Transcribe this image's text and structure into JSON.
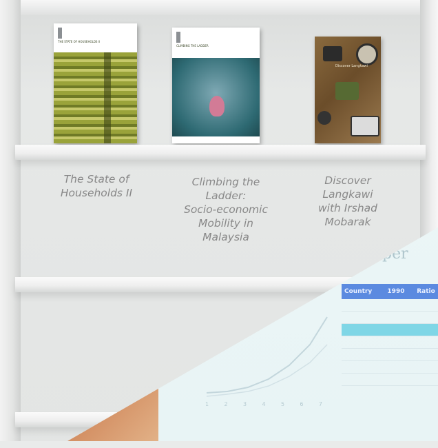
{
  "books": [
    {
      "cover_title": "THE STATE OF HOUSEHOLDS II",
      "caption": "The State of\nHouseholds II"
    },
    {
      "cover_title": "CLIMBING THE LADDER",
      "caption": "Climbing the\nLadder:\nSocio-economic\nMobility in\nMalaysia"
    },
    {
      "cover_title": "Discover Langkawi",
      "caption": "Discover\nLangkawi\nwith Irshad\nMobarak"
    }
  ],
  "overlay": {
    "title": "per",
    "table_header": [
      "Country",
      "1990",
      "Ratio"
    ],
    "table_rows": [
      [
        "",
        "",
        ""
      ],
      [
        "",
        "",
        ""
      ],
      [
        "",
        "",
        ""
      ],
      [
        "",
        "",
        ""
      ],
      [
        "",
        "",
        ""
      ],
      [
        "",
        "",
        ""
      ],
      [
        "",
        "",
        ""
      ]
    ]
  },
  "colors": {
    "caption_text": "#888888",
    "shelf_white": "#f2f2f2",
    "overlay_accent": "#5b8ae0",
    "overlay_highlight": "#7fd6e6"
  }
}
